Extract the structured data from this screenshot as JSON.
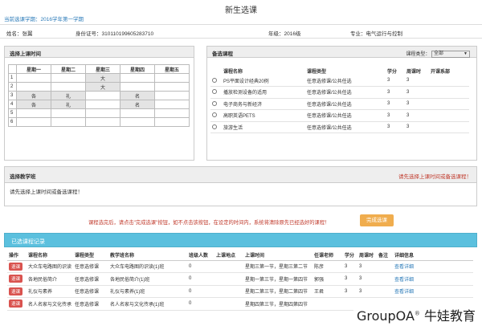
{
  "page_title": "新生选课",
  "semester": "当前选课学期：2016学年第一学期",
  "student": {
    "name": "姓名：张翼",
    "id_card": "身份证号：310110199605283710",
    "grade": "年级：2016级",
    "major": "专业：电气运行与控制"
  },
  "timetable": {
    "title": "选择上课时间",
    "days": [
      "星期一",
      "星期二",
      "星期三",
      "星期四",
      "星期五"
    ],
    "rows": [
      {
        "num": "1",
        "cells": [
          "",
          "",
          "大",
          "",
          ""
        ]
      },
      {
        "num": "2",
        "cells": [
          "",
          "",
          "大",
          "",
          ""
        ]
      },
      {
        "num": "3",
        "cells": [
          "各",
          "礼",
          "",
          "名",
          ""
        ]
      },
      {
        "num": "4",
        "cells": [
          "各",
          "礼",
          "",
          "名",
          ""
        ]
      },
      {
        "num": "5",
        "cells": [
          "",
          "",
          "",
          "",
          ""
        ]
      },
      {
        "num": "6",
        "cells": [
          "",
          "",
          "",
          "",
          ""
        ]
      }
    ]
  },
  "courses": {
    "title": "备选课程",
    "filter_label": "课程类型：",
    "filter_value": "全部",
    "headers": [
      "课程名称",
      "课程类型",
      "学分",
      "周课时",
      "开课系部"
    ],
    "items": [
      {
        "name": "PS平面设计经典20例",
        "type": "任意选修课/公共任选",
        "credit": "3",
        "hours": "3",
        "dept": ""
      },
      {
        "name": "播放检测设备的适用",
        "type": "任意选修课/公共任选",
        "credit": "3",
        "hours": "3",
        "dept": ""
      },
      {
        "name": "电子商务与新经济",
        "type": "任意选修课/公共任选",
        "credit": "3",
        "hours": "3",
        "dept": ""
      },
      {
        "name": "高职英语PETS",
        "type": "任意选修课/公共任选",
        "credit": "3",
        "hours": "3",
        "dept": ""
      },
      {
        "name": "旅游生活",
        "type": "任意选修课/公共任选",
        "credit": "3",
        "hours": "3",
        "dept": ""
      }
    ]
  },
  "class_select": {
    "title": "选择教学班",
    "hint": "请先选择上课时间或备选课程！",
    "body": "请先选择上课时间或备选课程！"
  },
  "notice": "课程选完后，请点击\"完成选课\"按钮，如不点击该按钮，在设定的时间内，系统将清除原先已经选好的课程！",
  "finish_button": "完成选课",
  "selected": {
    "title": "已选课程记录",
    "headers": [
      "操作",
      "课程名称",
      "课程类型",
      "教学班名称",
      "班级人数",
      "上课地点",
      "上课时间",
      "任课老师",
      "学分",
      "周课时",
      "备注",
      "详细信息"
    ],
    "withdraw_label": "退课",
    "detail_label": "查看详细",
    "rows": [
      {
        "course": "大众车电路图的识读",
        "type": "任意选修课",
        "class": "大众车电路图的识读(1)班",
        "size": "0",
        "place": "",
        "time": "星期三第一节，星期三第二节",
        "teacher": "陈彦",
        "credit": "3",
        "hours": "3",
        "note": ""
      },
      {
        "course": "各地民俗简介",
        "type": "任意选修课",
        "class": "各地民俗简介(1)班",
        "size": "0",
        "place": "",
        "time": "星期一第三节，星期一第四节",
        "teacher": "郭强",
        "credit": "3",
        "hours": "3",
        "note": ""
      },
      {
        "course": "礼仪与素养",
        "type": "任意选修课",
        "class": "礼仪与素养(1)班",
        "size": "0",
        "place": "",
        "time": "星期二第三节，星期二第四节",
        "teacher": "王君",
        "credit": "3",
        "hours": "3",
        "note": ""
      },
      {
        "course": "名人名家与文化传承",
        "type": "任意选修课",
        "class": "名人名家与文化传承(1)班",
        "size": "0",
        "place": "",
        "time": "星期四第三节，星期四第四节",
        "teacher": "",
        "credit": "",
        "hours": "",
        "note": ""
      }
    ]
  },
  "watermark": {
    "text": "GroupOA",
    "mark": "®",
    "suffix": " 牛娃教育"
  }
}
